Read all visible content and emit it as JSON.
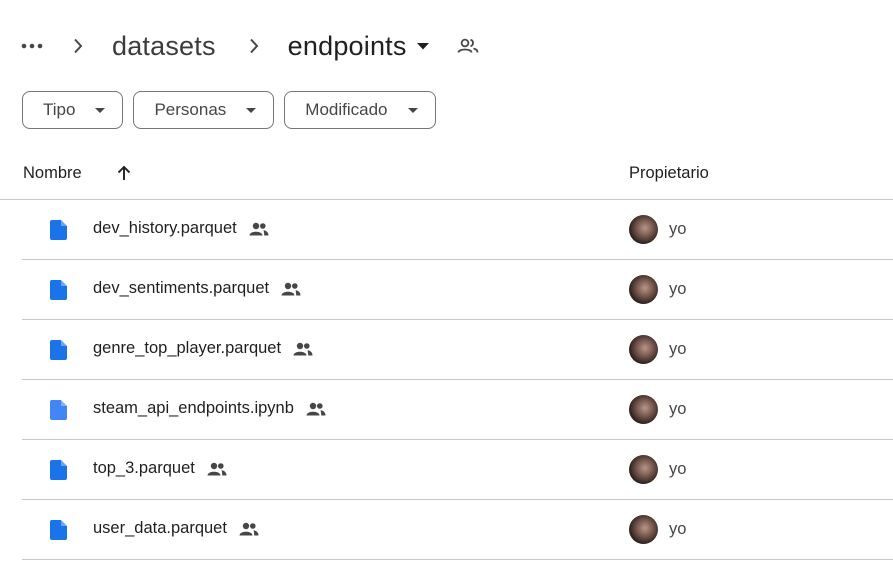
{
  "breadcrumb": {
    "more_icon": "more-horiz-icon",
    "parent": "datasets",
    "current": "endpoints",
    "shared_icon": "people-outline-icon"
  },
  "filters": [
    {
      "label": "Tipo"
    },
    {
      "label": "Personas"
    },
    {
      "label": "Modificado"
    }
  ],
  "table": {
    "columns": {
      "name": "Nombre",
      "owner": "Propietario"
    },
    "sort": "ascending",
    "rows": [
      {
        "name": "dev_history.parquet",
        "owner": "yo",
        "icon": "file-icon",
        "shared": true,
        "icon_color": "#1a73e8"
      },
      {
        "name": "dev_sentiments.parquet",
        "owner": "yo",
        "icon": "file-icon",
        "shared": true,
        "icon_color": "#1a73e8"
      },
      {
        "name": "genre_top_player.parquet",
        "owner": "yo",
        "icon": "file-icon",
        "shared": true,
        "icon_color": "#1a73e8"
      },
      {
        "name": "steam_api_endpoints.ipynb",
        "owner": "yo",
        "icon": "notebook-file-icon",
        "shared": true,
        "icon_color": "#4285f4"
      },
      {
        "name": "top_3.parquet",
        "owner": "yo",
        "icon": "file-icon",
        "shared": true,
        "icon_color": "#1a73e8"
      },
      {
        "name": "user_data.parquet",
        "owner": "yo",
        "icon": "file-icon",
        "shared": true,
        "icon_color": "#1a73e8"
      }
    ]
  },
  "colors": {
    "text": "#1f1f1f",
    "muted": "#444746",
    "border": "#c7c7c7",
    "chip_border": "#747775",
    "file_blue": "#1a73e8"
  }
}
